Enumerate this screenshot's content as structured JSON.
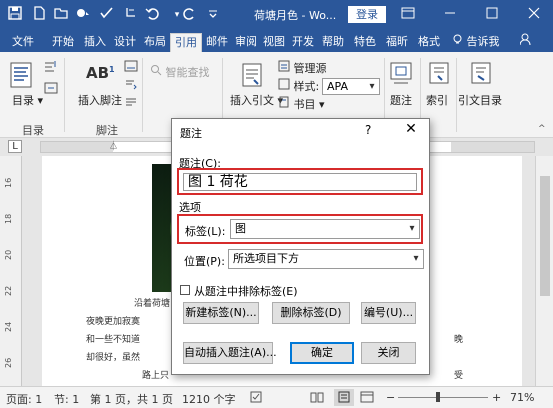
{
  "titlebar": {
    "doc_title": "荷塘月色 - Wo...",
    "login": "登录",
    "icons": [
      "save-icon",
      "new-doc-icon",
      "open-icon",
      "touch-mode-icon",
      "spelling-icon",
      "redo-icon",
      "undo-icon",
      "customize-qa-icon"
    ]
  },
  "tabs": [
    "文件",
    "开始",
    "插入",
    "设计",
    "布局",
    "引用",
    "邮件",
    "审阅",
    "视图",
    "开发",
    "帮助",
    "特色",
    "福昕",
    "格式"
  ],
  "active_tab": "引用",
  "tell_me": "告诉我",
  "ribbon": {
    "toc": "目录",
    "group_toc": "目录",
    "insert_footnote": "插入脚注",
    "ab_label": "AB",
    "group_footnote": "脚注",
    "smart_lookup": "智能查找",
    "insert_citation": "插入引文",
    "manage_sources": "管理源",
    "style_label": "样式:",
    "style_value": "APA",
    "bibliography": "书目",
    "caption": "题注",
    "index": "索引",
    "toa": "引文目录"
  },
  "ruler": {
    "vertical_numbers": [
      "16",
      "18",
      "20",
      "22",
      "24",
      "26"
    ]
  },
  "document": {
    "lines": [
      "沿着荷塘",
      "夜晚更加寂寞",
      "和一些不知道",
      "却很好，虽然",
      "路上只"
    ],
    "right_fragments": [
      "晚",
      "受"
    ]
  },
  "dialog": {
    "title": "题注",
    "help": "?",
    "caption_label": "题注(C):",
    "caption_value": "图 1 荷花",
    "options_label": "选项",
    "label_label": "标签(L):",
    "label_value": "图",
    "position_label": "位置(P):",
    "position_value": "所选项目下方",
    "exclude_label": "从题注中排除标签(E)",
    "new_label_btn": "新建标签(N)...",
    "delete_label_btn": "删除标签(D)",
    "numbering_btn": "编号(U)...",
    "autocaption_btn": "自动插入题注(A)...",
    "ok_btn": "确定",
    "close_btn": "关闭"
  },
  "status": {
    "page": "页面: 1",
    "section": "节: 1",
    "page_of": "第 1 页，共 1 页",
    "words": "1210 个字",
    "zoom": "71%"
  },
  "colors": {
    "word_blue": "#2b579a",
    "highlight_red": "#d62b2b"
  }
}
